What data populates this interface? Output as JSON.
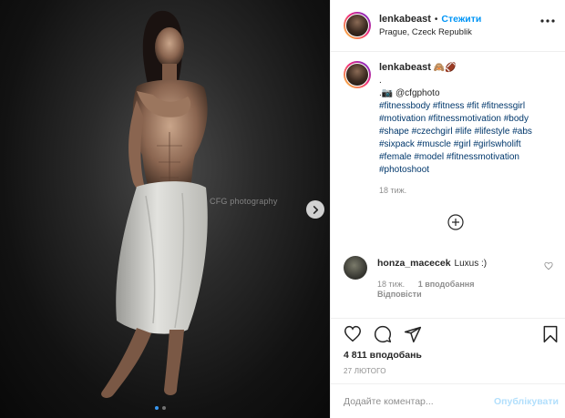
{
  "post": {
    "author": {
      "username": "lenkabeast",
      "follow_label": "Стежити",
      "location": "Prague, Czeck Republik"
    },
    "media": {
      "watermark": "CFG photography",
      "slide_count": 2,
      "active_slide": 1
    },
    "caption": {
      "username": "lenkabeast",
      "emoji": "🙈🏈",
      "lines": [
        ".",
        ".📷 @cfgphoto"
      ],
      "hashtags": "#fitnessbody #fitness #fit #fitnessgirl #motivation #fitnessmotivation #body #shape #czechgirl #life #lifestyle #abs #sixpack #muscle #girl #girlswholift #female #model #fitnessmotivation #photoshoot",
      "time": "18 тиж."
    },
    "comments": [
      {
        "username": "honza_macecek",
        "text": "Luxus :)",
        "time": "18 тиж.",
        "likes": "1 вподобання",
        "reply_label": "Відповісти"
      }
    ],
    "likes_text": "4 811 вподобань",
    "date": "27 ЛЮТОГО",
    "composer": {
      "placeholder": "Додайте коментар...",
      "publish_label": "Опублікувати"
    },
    "icons": {
      "more": "more-horizontal-icon",
      "like": "heart-icon",
      "comment": "comment-icon",
      "share": "share-icon",
      "save": "bookmark-icon",
      "load_more": "plus-circle-icon",
      "next": "chevron-right-icon"
    },
    "colors": {
      "accent": "#0095f6",
      "link": "#00376b",
      "muted": "#8e8e8e",
      "dot_active": "#3897f0"
    }
  }
}
